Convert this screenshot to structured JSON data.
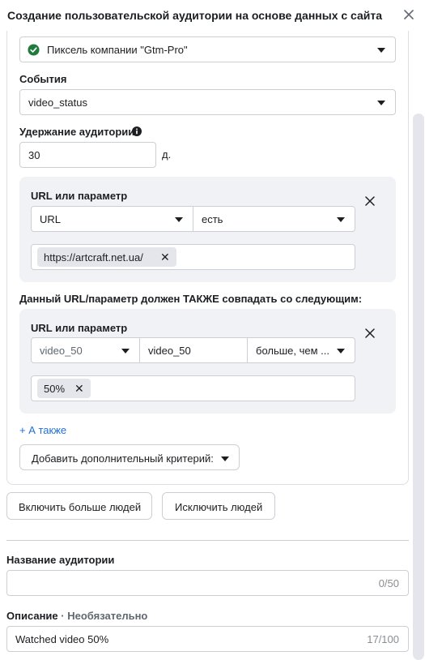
{
  "dialog": {
    "title": "Создание пользовательской аудитории на основе данных с сайта"
  },
  "source": {
    "value": "Пиксель компании \"Gtm-Pro\""
  },
  "events": {
    "label": "События",
    "value": "video_status"
  },
  "retention": {
    "label": "Удержание аудитории",
    "value": "30",
    "unit": "д."
  },
  "rule1": {
    "label": "URL или параметр",
    "field": "URL",
    "operator": "есть",
    "chips": [
      "https://artcraft.net.ua/"
    ]
  },
  "also_match_label": "Данный URL/параметр должен ТАКЖЕ совпадать со следующим:",
  "rule2": {
    "label": "URL или параметр",
    "param": "video_50",
    "value": "video_50",
    "operator": "больше, чем ...",
    "chips": [
      "50%"
    ]
  },
  "also_link": "+ А также",
  "add_criteria_button": "Добавить дополнительный критерий:",
  "include_more_button": "Включить больше людей",
  "exclude_button": "Исключить людей",
  "audience_name": {
    "label": "Название аудитории",
    "value": "",
    "counter": "0/50"
  },
  "description": {
    "label": "Описание",
    "optional": " · Необязательно",
    "value": "Watched video 50%",
    "counter": "17/100"
  },
  "colors": {
    "accent": "#216fdb",
    "success": "#1e7b3b",
    "panel_bg": "#f0f2f5",
    "border": "#ccd0d5"
  }
}
